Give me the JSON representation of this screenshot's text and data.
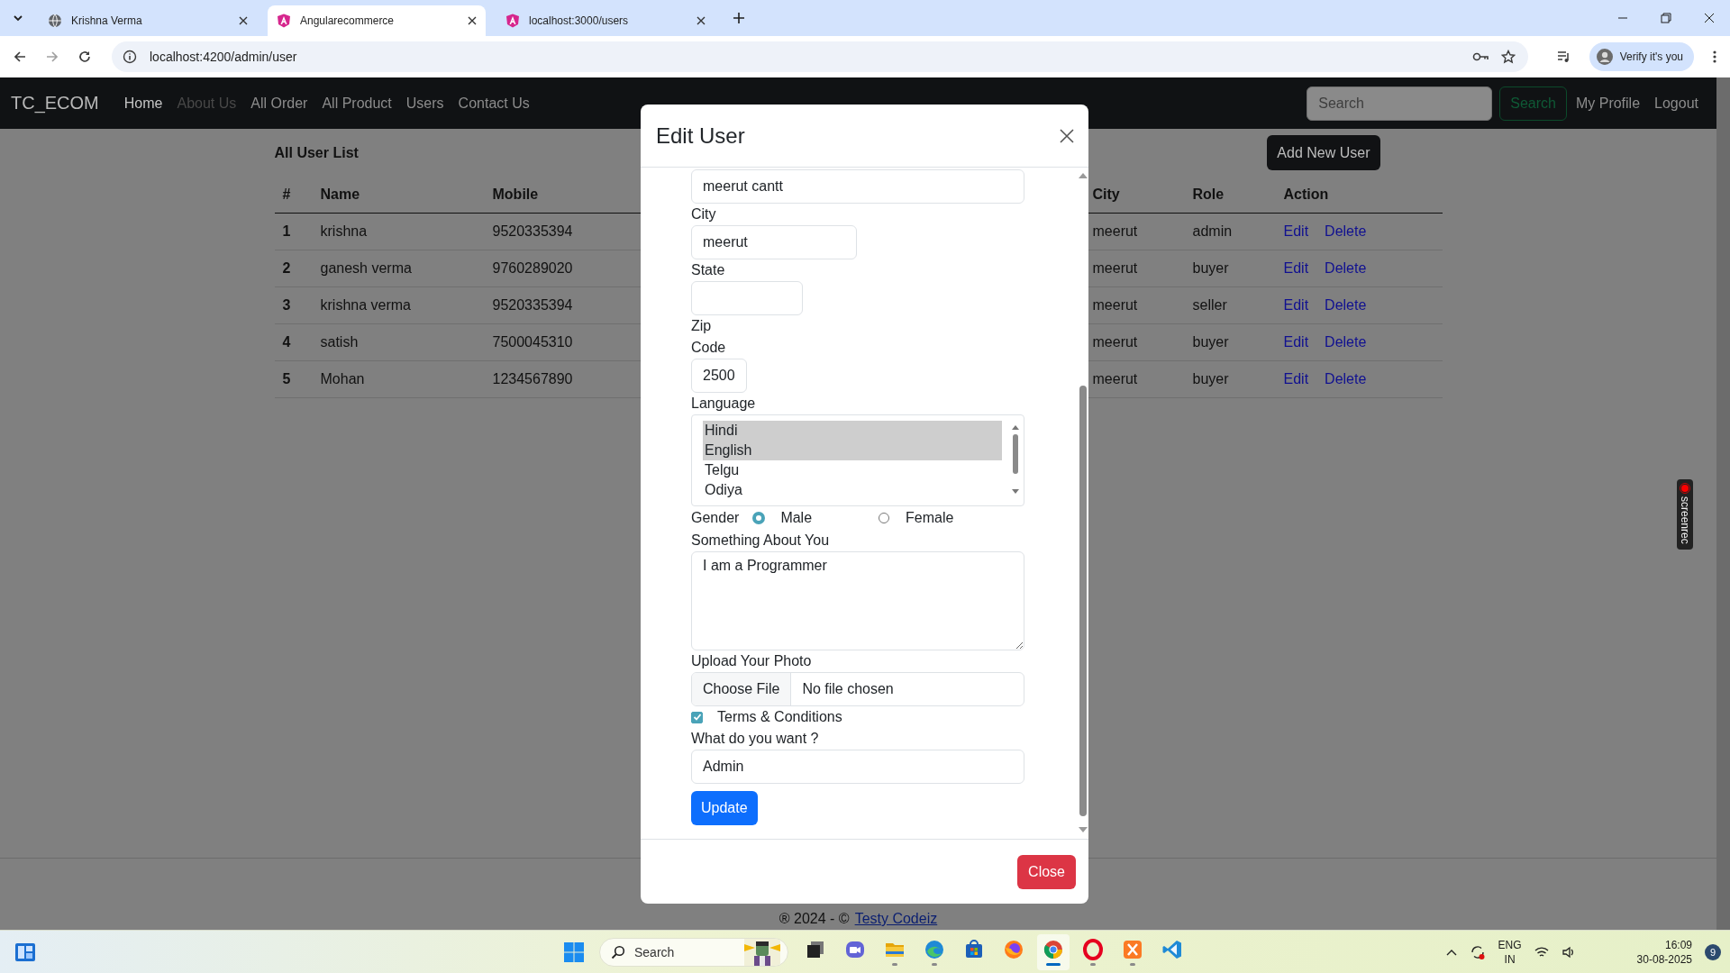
{
  "browser": {
    "tabs": [
      {
        "title": "Krishna Verma",
        "selected": false,
        "kind": "globe"
      },
      {
        "title": "Angularecommerce",
        "selected": true,
        "kind": "shield"
      },
      {
        "title": "localhost:3000/users",
        "selected": false,
        "kind": "shield"
      }
    ],
    "address": "localhost:4200/admin/user",
    "profile_button": "Verify it's you"
  },
  "navbar": {
    "brand": "TC_ECOM",
    "links": [
      {
        "label": "Home",
        "selected": true,
        "disabled": false
      },
      {
        "label": "About Us",
        "selected": false,
        "disabled": true
      },
      {
        "label": "All Order",
        "selected": false,
        "disabled": false
      },
      {
        "label": "All Product",
        "selected": false,
        "disabled": false
      },
      {
        "label": "Users",
        "selected": false,
        "disabled": false
      },
      {
        "label": "Contact Us",
        "selected": false,
        "disabled": false
      }
    ],
    "search": {
      "placeholder": "Search"
    },
    "search_button": "Search",
    "right_links": [
      "My Profile",
      "Logout"
    ]
  },
  "page": {
    "title": "All User List",
    "add_button": "Add New User",
    "table": {
      "columns": [
        "#",
        "Name",
        "Mobile",
        "City",
        "Role",
        "Action"
      ],
      "rows": [
        {
          "index": "1",
          "name": "krishna",
          "mobile": "9520335394",
          "city": "meerut",
          "role": "admin",
          "actions": [
            "Edit",
            "Delete"
          ]
        },
        {
          "index": "2",
          "name": "ganesh verma",
          "mobile": "9760289020",
          "city": "meerut",
          "role": "buyer",
          "actions": [
            "Edit",
            "Delete"
          ]
        },
        {
          "index": "3",
          "name": "krishna verma",
          "mobile": "9520335394",
          "city": "meerut",
          "role": "seller",
          "actions": [
            "Edit",
            "Delete"
          ]
        },
        {
          "index": "4",
          "name": "satish",
          "mobile": "7500045310",
          "city": "meerut",
          "role": "buyer",
          "actions": [
            "Edit",
            "Delete"
          ]
        },
        {
          "index": "5",
          "name": "Mohan",
          "mobile": "1234567890",
          "city": "meerut",
          "role": "buyer",
          "actions": [
            "Edit",
            "Delete"
          ]
        }
      ]
    }
  },
  "footer": {
    "text": "® 2024 - ©",
    "link": "Testy Codeiz"
  },
  "modal": {
    "title": "Edit User",
    "fields": [
      {
        "kind": "text",
        "value": "meerut cantt"
      },
      {
        "kind": "text",
        "label": "City",
        "value": "meerut"
      },
      {
        "kind": "text",
        "label": "State"
      },
      {
        "kind": "text",
        "label": "Zip Code",
        "value": "2500"
      },
      {
        "kind": "listbox",
        "label": "Language",
        "options": [
          {
            "label": "Hindi",
            "selected": true
          },
          {
            "label": "English",
            "selected": true
          },
          {
            "label": "Telgu",
            "selected": false
          },
          {
            "label": "Odiya",
            "selected": false
          }
        ]
      },
      {
        "kind": "radio",
        "label": "Gender",
        "options": [
          {
            "label": "Male",
            "selected": true
          },
          {
            "label": "Female",
            "selected": false
          }
        ]
      },
      {
        "kind": "textarea",
        "label": "Something About You",
        "value": "I am a Programmer"
      },
      {
        "kind": "file",
        "label": "Upload Your Photo",
        "button": "Choose File",
        "status": "No file chosen"
      },
      {
        "kind": "checkbox",
        "label": "Terms & Conditions",
        "checked": true
      },
      {
        "kind": "text",
        "label": "What do you want ?",
        "value": "Admin"
      },
      {
        "kind": "button",
        "label": "Update"
      }
    ],
    "close_button": "Close"
  },
  "recorder": {
    "label": "screenrec"
  },
  "taskbar": {
    "search": {
      "placeholder": "Search"
    },
    "apps": [
      {
        "kind": "taskview",
        "running": false,
        "selected": false
      },
      {
        "kind": "chat",
        "running": false,
        "selected": false
      },
      {
        "kind": "folder",
        "running": true,
        "selected": false
      },
      {
        "kind": "edge",
        "running": true,
        "selected": false
      },
      {
        "kind": "store",
        "running": false,
        "selected": false
      },
      {
        "kind": "firefox",
        "running": false,
        "selected": false
      },
      {
        "kind": "chrome",
        "running": true,
        "selected": true
      },
      {
        "kind": "opera",
        "running": true,
        "selected": false
      },
      {
        "kind": "xampp",
        "running": true,
        "selected": false
      },
      {
        "kind": "vscode",
        "running": false,
        "selected": false
      }
    ],
    "language": [
      "ENG",
      "IN"
    ],
    "time": "16:09",
    "date": "30-08-2025",
    "notifications": "9"
  }
}
